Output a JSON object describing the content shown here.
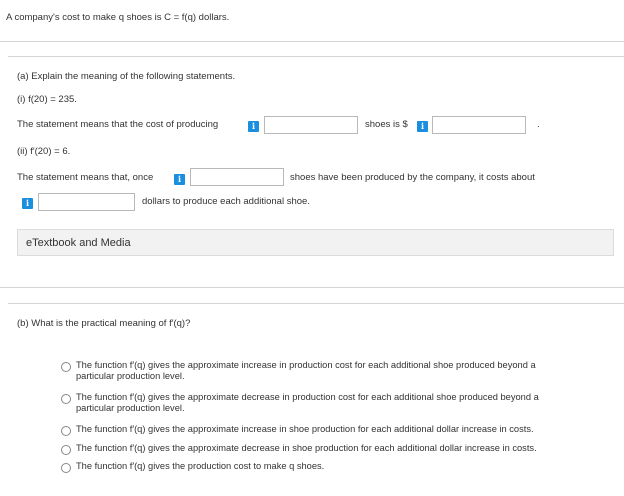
{
  "intro": "A company's cost to make q shoes is C = f(q) dollars.",
  "part_a": {
    "prompt": "(a) Explain the meaning of the following statements.",
    "stmt1": "(i) f(20) = 235.",
    "line1_prefix": "The statement means that the cost of producing",
    "line1_mid": "shoes is $",
    "line1_end": ".",
    "stmt2": "(ii) f′(20) = 6.",
    "line2_prefix": "The statement means that, once",
    "line2_mid": "shoes have been produced by the company, it costs about",
    "line3_suffix": "dollars to produce each additional shoe.",
    "info_glyph": "i"
  },
  "etextbook_label": "eTextbook and Media",
  "part_b": {
    "prompt": "(b) What is the practical meaning of f′(q)?",
    "options": [
      "The function f′(q) gives the approximate increase in production cost for each additional shoe produced beyond a particular production level.",
      "The function f′(q) gives the approximate decrease in production cost for each additional shoe produced beyond a particular production level.",
      "The function f′(q) gives the approximate increase in shoe production for each additional dollar increase in costs.",
      "The function f′(q) gives the approximate decrease in shoe production for each additional dollar increase in costs.",
      "The function f′(q) gives the production cost to make q shoes."
    ]
  },
  "colors": {
    "info": "#1a8fe0",
    "panel": "#f2f2f2",
    "rule": "#d4d4d4"
  }
}
